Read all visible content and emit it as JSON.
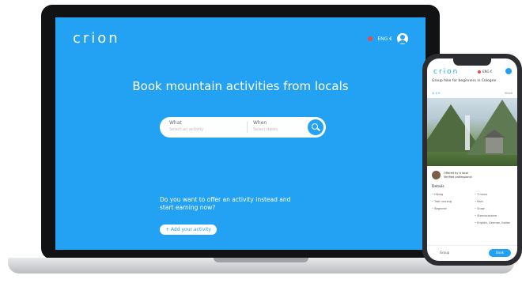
{
  "brand": {
    "name": "crion",
    "accent": "#23a2f3"
  },
  "laptop": {
    "header": {
      "lang": "ENG €"
    },
    "hero": {
      "title": "Book mountain activities from locals"
    },
    "search": {
      "what_label": "What",
      "what_placeholder": "Select an activity",
      "where_label": "When",
      "where_placeholder": "Select dates"
    },
    "offer": {
      "text": "Do you want to offer an activity instead and start earning now?",
      "button": "+ Add your activity"
    }
  },
  "phone": {
    "header": {
      "lang": "ENG €"
    },
    "title": "Group hike for beginners in Cologne",
    "meta": "★ 4.9",
    "share": "Share",
    "host": {
      "name": "Offered by a local",
      "sub": "Verified professional"
    },
    "details_heading": "Details",
    "details_left": [
      "Hiking",
      "Trail running",
      "Beginner"
    ],
    "details_right": [
      "3 hours",
      "Rain",
      "Snow",
      "Stornocazione",
      "English, German, Italian"
    ],
    "footer": {
      "label": "Group",
      "button": "Book"
    }
  }
}
